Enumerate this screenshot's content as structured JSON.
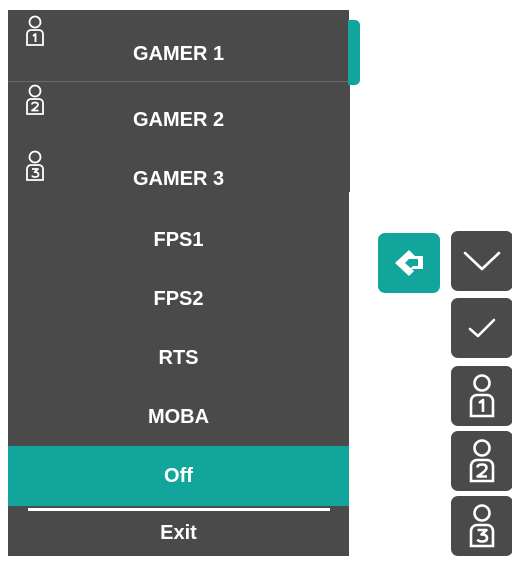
{
  "menu": {
    "items": [
      {
        "label": "GAMER 1",
        "icon": "user-1-icon"
      },
      {
        "label": "GAMER 2",
        "icon": "user-2-icon"
      },
      {
        "label": "GAMER 3",
        "icon": "user-3-icon"
      },
      {
        "label": "FPS1"
      },
      {
        "label": "FPS2"
      },
      {
        "label": "RTS"
      },
      {
        "label": "MOBA"
      },
      {
        "label": "Off",
        "selected": true
      },
      {
        "label": "Exit"
      }
    ]
  },
  "controls": {
    "buttons": [
      {
        "name": "gigabyte-logo-button",
        "icon": "gigabyte-logo-icon"
      },
      {
        "name": "down-button",
        "icon": "chevron-down-icon"
      },
      {
        "name": "confirm-button",
        "icon": "checkmark-icon"
      },
      {
        "name": "gamer-1-button",
        "icon": "user-1-icon",
        "digit": "1"
      },
      {
        "name": "gamer-2-button",
        "icon": "user-2-icon",
        "digit": "2"
      },
      {
        "name": "gamer-3-button",
        "icon": "user-3-icon",
        "digit": "3"
      }
    ]
  },
  "colors": {
    "accent": "#12a59b",
    "panel": "#4a4a4a",
    "text": "#ffffff"
  }
}
